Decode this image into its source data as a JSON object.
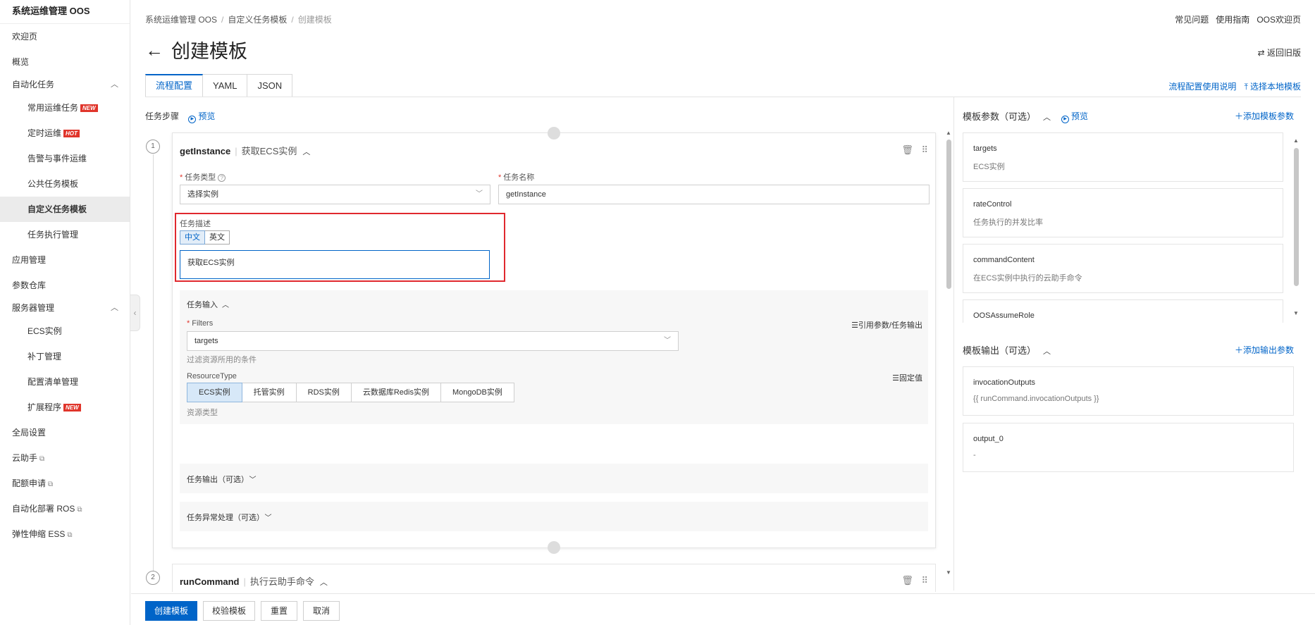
{
  "sidebar": {
    "title": "系统运维管理 OOS",
    "items": [
      {
        "label": "欢迎页"
      },
      {
        "label": "概览"
      },
      {
        "label": "自动化任务",
        "chevron": "^"
      },
      {
        "label": "常用运维任务",
        "badge": "NEW"
      },
      {
        "label": "定时运维",
        "badge": "HOT"
      },
      {
        "label": "告警与事件运维"
      },
      {
        "label": "公共任务模板"
      },
      {
        "label": "自定义任务模板"
      },
      {
        "label": "任务执行管理"
      },
      {
        "label": "应用管理"
      },
      {
        "label": "参数仓库"
      },
      {
        "label": "服务器管理",
        "chevron": "^"
      },
      {
        "label": "ECS实例"
      },
      {
        "label": "补丁管理"
      },
      {
        "label": "配置清单管理"
      },
      {
        "label": "扩展程序",
        "badge": "NEW"
      },
      {
        "label": "全局设置"
      },
      {
        "label": "云助手"
      },
      {
        "label": "配额申请"
      },
      {
        "label": "自动化部署 ROS"
      },
      {
        "label": "弹性伸缩 ESS"
      }
    ]
  },
  "breadcrumb": [
    "系统运维管理 OOS",
    "自定义任务模板",
    "创建模板"
  ],
  "toplinks": [
    "常见问题",
    "使用指南",
    "OOS欢迎页"
  ],
  "page": {
    "title": "创建模板",
    "return_old": "返回旧版"
  },
  "tabs": [
    "流程配置",
    "YAML",
    "JSON"
  ],
  "right_links": {
    "usage": "流程配置使用说明",
    "local": "选择本地模板"
  },
  "steps": {
    "label": "任务步骤",
    "preview": "预览",
    "step1": {
      "num": "1",
      "name": "getInstance",
      "desc": "获取ECS实例",
      "type_label": "任务类型",
      "type_value": "选择实例",
      "name_label": "任务名称",
      "name_value": "getInstance",
      "desc_label": "任务描述",
      "lang_cn": "中文",
      "lang_en": "英文",
      "desc_value": "获取ECS实例",
      "input": {
        "title": "任务输入",
        "filters_label": "Filters",
        "filters_value": "targets",
        "filters_hint": "过滤资源所用的条件",
        "ref_link": "引用参数/任务输出",
        "resource_label": "ResourceType",
        "fixed_link": "固定值",
        "resource_options": [
          "ECS实例",
          "托管实例",
          "RDS实例",
          "云数据库Redis实例",
          "MongoDB实例"
        ],
        "resource_hint": "资源类型"
      },
      "output_title": "任务输出（可选）",
      "error_title": "任务异常处理（可选）"
    },
    "step2": {
      "num": "2",
      "name": "runCommand",
      "desc": "执行云助手命令"
    }
  },
  "params_panel": {
    "title": "模板参数（可选）",
    "preview": "预览",
    "add": "添加模板参数",
    "items": [
      {
        "name": "targets",
        "desc": "ECS实例"
      },
      {
        "name": "rateControl",
        "desc": "任务执行的并发比率"
      },
      {
        "name": "commandContent",
        "desc": "在ECS实例中执行的云助手命令"
      },
      {
        "name": "OOSAssumeRole",
        "desc": ""
      }
    ]
  },
  "outputs_panel": {
    "title": "模板输出（可选）",
    "add": "添加输出参数",
    "items": [
      {
        "name": "invocationOutputs",
        "desc": "{{ runCommand.invocationOutputs }}"
      },
      {
        "name": "output_0",
        "desc": "-"
      }
    ]
  },
  "buttons": {
    "create": "创建模板",
    "validate": "校验模板",
    "reset": "重置",
    "cancel": "取消"
  },
  "colors": {
    "accent": "#0064c8",
    "highlight": "#e0282e",
    "badge": "#e0352b"
  }
}
